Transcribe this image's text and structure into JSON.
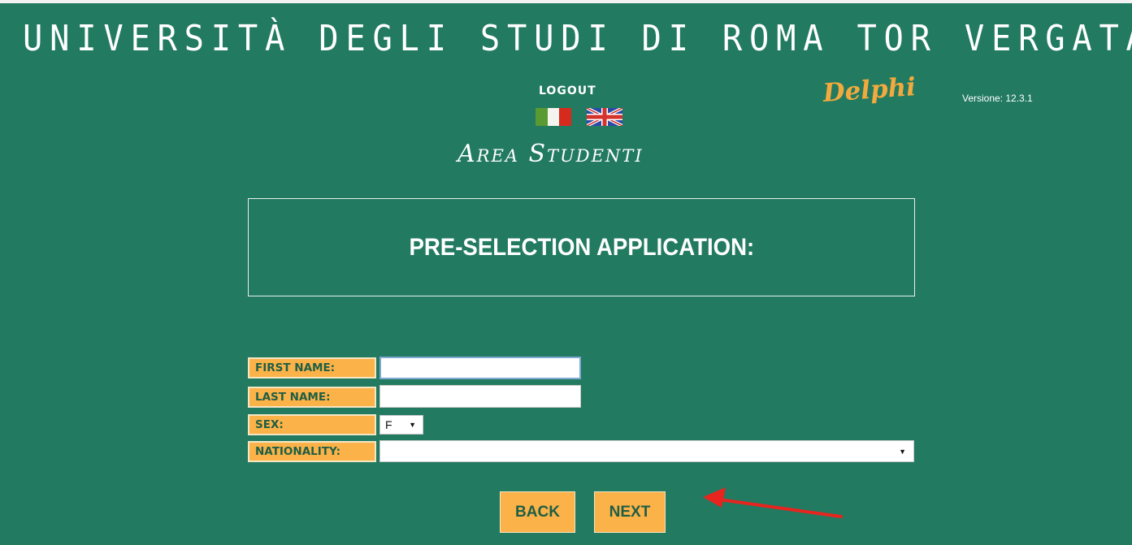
{
  "header": {
    "university": "UNIVERSITÀ DEGLI STUDI DI ROMA TOR VERGATA",
    "logout": "LOGOUT",
    "brand": "Delphi",
    "version": "Versione: 12.3.1",
    "area": "Area Studenti"
  },
  "languages": [
    {
      "icon": "italian-flag-icon"
    },
    {
      "icon": "uk-flag-icon"
    }
  ],
  "page": {
    "title": "PRE-SELECTION APPLICATION:"
  },
  "form": {
    "first_name": {
      "label": "FIRST NAME:",
      "value": ""
    },
    "last_name": {
      "label": "LAST NAME:",
      "value": ""
    },
    "sex": {
      "label": "SEX:",
      "value": "F"
    },
    "nationality": {
      "label": "NATIONALITY:",
      "value": ""
    }
  },
  "buttons": {
    "back": "BACK",
    "next": "NEXT"
  },
  "annotation": {
    "icon": "red-arrow-icon",
    "color": "#e8241f"
  },
  "colors": {
    "background": "#227a61",
    "accent": "#fbb248",
    "label_text": "#1f5e45",
    "brand": "#f2a93d"
  }
}
